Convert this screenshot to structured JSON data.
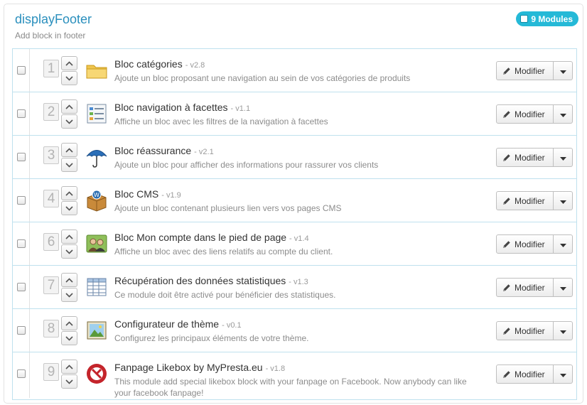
{
  "hook": {
    "title": "displayFooter",
    "description": "Add block in footer",
    "badge_label": "9 Modules"
  },
  "colors": {
    "title": "#2a8fbd",
    "badge": "#25b9d7",
    "row_border": "#bfe1ee"
  },
  "action_label": "Modifier",
  "modules": [
    {
      "position": "1",
      "name": "Bloc catégories",
      "version": "- v2.8",
      "description": "Ajoute un bloc proposant une navigation au sein de vos catégories de produits",
      "icon": "folder-icon"
    },
    {
      "position": "2",
      "name": "Bloc navigation à facettes",
      "version": "- v1.1",
      "description": "Affiche un bloc avec les filtres de la navigation à facettes",
      "icon": "filter-list-icon"
    },
    {
      "position": "3",
      "name": "Bloc réassurance",
      "version": "- v2.1",
      "description": "Ajoute un bloc pour afficher des informations pour rassurer vos clients",
      "icon": "umbrella-icon"
    },
    {
      "position": "4",
      "name": "Bloc CMS",
      "version": "- v1.9",
      "description": "Ajoute un bloc contenant plusieurs lien vers vos pages CMS",
      "icon": "cms-box-icon"
    },
    {
      "position": "6",
      "name": "Bloc Mon compte dans le pied de page",
      "version": "- v1.4",
      "description": "Affiche un bloc avec des liens relatifs au compte du client.",
      "icon": "users-icon"
    },
    {
      "position": "7",
      "name": "Récupération des données statistiques",
      "version": "- v1.3",
      "description": "Ce module doit être activé pour bénéficier des statistiques.",
      "icon": "spreadsheet-icon"
    },
    {
      "position": "8",
      "name": "Configurateur de thème",
      "version": "- v0.1",
      "description": "Configurez les principaux éléments de votre thème.",
      "icon": "picture-icon"
    },
    {
      "position": "9",
      "name": "Fanpage Likebox by MyPresta.eu",
      "version": "- v1.8",
      "description": "This module add special likebox block with your fanpage on Facebook. Now anybody can like your facebook fanpage!",
      "icon": "mypresta-logo-icon"
    }
  ]
}
